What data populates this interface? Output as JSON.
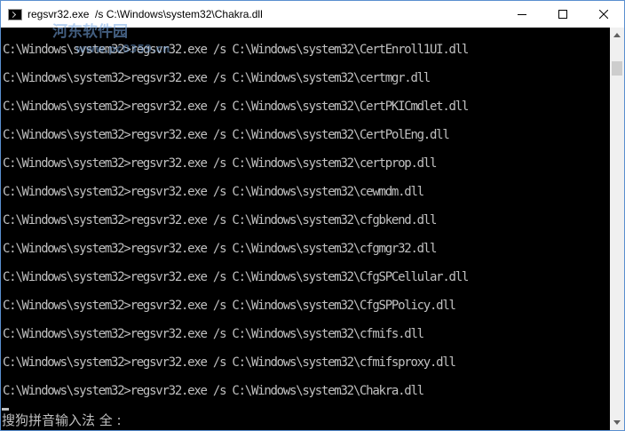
{
  "window": {
    "title": "regsvr32.exe  /s C:\\Windows\\system32\\Chakra.dll",
    "app_icon": "console-icon",
    "controls": {
      "minimize": "minimize-icon",
      "maximize": "maximize-icon",
      "close": "close-icon"
    }
  },
  "console": {
    "lines": [
      "C:\\Windows\\system32>regsvr32.exe /s C:\\Windows\\system32\\CertEnroll1UI.dll",
      "C:\\Windows\\system32>regsvr32.exe /s C:\\Windows\\system32\\certmgr.dll",
      "C:\\Windows\\system32>regsvr32.exe /s C:\\Windows\\system32\\CertPKICmdlet.dll",
      "C:\\Windows\\system32>regsvr32.exe /s C:\\Windows\\system32\\CertPolEng.dll",
      "C:\\Windows\\system32>regsvr32.exe /s C:\\Windows\\system32\\certprop.dll",
      "C:\\Windows\\system32>regsvr32.exe /s C:\\Windows\\system32\\cewmdm.dll",
      "C:\\Windows\\system32>regsvr32.exe /s C:\\Windows\\system32\\cfgbkend.dll",
      "C:\\Windows\\system32>regsvr32.exe /s C:\\Windows\\system32\\cfgmgr32.dll",
      "C:\\Windows\\system32>regsvr32.exe /s C:\\Windows\\system32\\CfgSPCellular.dll",
      "C:\\Windows\\system32>regsvr32.exe /s C:\\Windows\\system32\\CfgSPPolicy.dll",
      "C:\\Windows\\system32>regsvr32.exe /s C:\\Windows\\system32\\cfmifs.dll",
      "C:\\Windows\\system32>regsvr32.exe /s C:\\Windows\\system32\\cfmifsproxy.dll",
      "C:\\Windows\\system32>regsvr32.exe /s C:\\Windows\\system32\\Chakra.dll"
    ],
    "ime_status": "搜狗拼音输入法 全 :"
  },
  "watermark": {
    "text": "河东软件园",
    "url": "www.pc0359.cn"
  },
  "colors": {
    "console_bg": "#000000",
    "console_fg": "#c0c0c0",
    "titlebar_bg": "#ffffff",
    "border": "#5a8fcf",
    "scrollbar_bg": "#f0f0f0",
    "scroll_thumb": "#cdcdcd"
  }
}
